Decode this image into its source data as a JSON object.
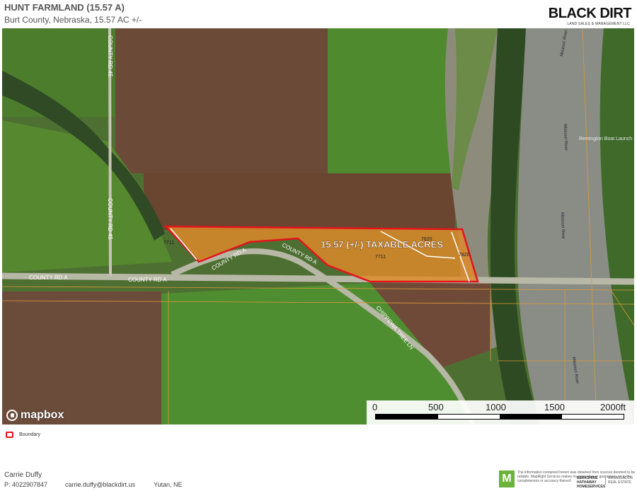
{
  "header": {
    "title": "HUNT FARMLAND (15.57 A)",
    "subtitle": "Burt County, Nebraska, 15.57 AC +/-",
    "logo_main": "BLACK DIRT",
    "logo_sub": "LAND SALES & MANAGEMENT LLC"
  },
  "map": {
    "parcel_label": "15.57 (+/-) TAXABLE ACRES",
    "parcel_ids": [
      "7711",
      "7711",
      "7820",
      "7820"
    ],
    "road_labels": [
      "COUNTY RD 45",
      "COUNTY RD 45",
      "COUNTY RD A",
      "COUNTY RD A",
      "COUNTY RD A",
      "COUNTY RD A",
      "CHIPPEWA TREE LN"
    ],
    "river_labels": [
      "Missouri River",
      "Missouri River",
      "Missouri River",
      "Missouri River"
    ],
    "poi_label": "Remington Boat Launch",
    "attribution": "mapbox",
    "boundary_color": "#e2141c",
    "parcel_fill": "#e08a2a"
  },
  "scale": {
    "labels": [
      "0",
      "500",
      "1000",
      "1500",
      "2000ft"
    ]
  },
  "legend": {
    "label": "Boundary"
  },
  "footer": {
    "agent_name": "Carrie Duffy",
    "phone": "P: 4022907847",
    "email": "carrie.duffy@blackdirt.us",
    "city": "Yutan, NE",
    "badge": "M",
    "disclaimer": "The information contained herein was obtained from sources deemed to be reliable. MapRight Services makes no warranties or guarantees as to the completeness or accuracy thereof.",
    "bh_line1": "BERKSHIRE",
    "bh_line2": "HATHAWAY",
    "bh_line3": "HOMESERVICES",
    "amb_line1": "AMBASSADOR",
    "amb_line2": "REAL ESTATE"
  }
}
